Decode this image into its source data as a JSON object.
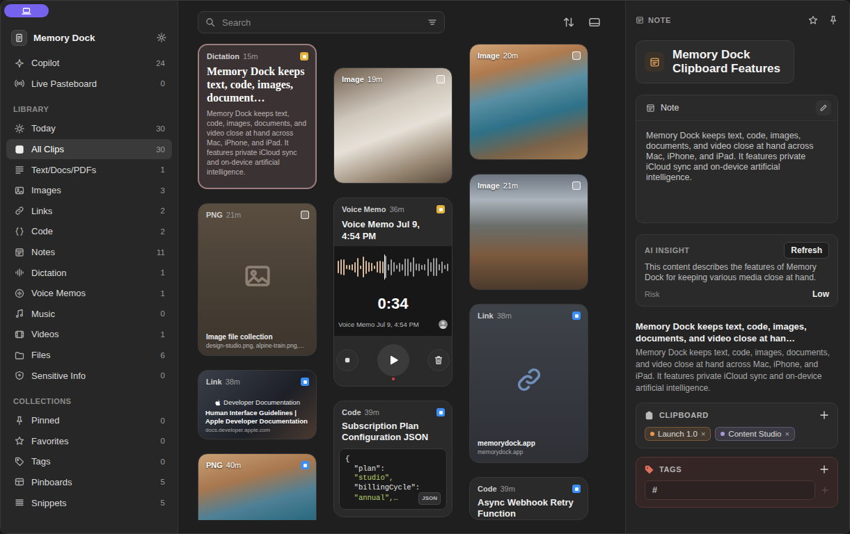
{
  "sidebar": {
    "title": "Memory Dock",
    "top": [
      {
        "label": "Copilot",
        "count": "24",
        "selected": false
      },
      {
        "label": "Live Pasteboard",
        "count": "0",
        "selected": false
      }
    ],
    "sections": [
      {
        "title": "LIBRARY",
        "items": [
          {
            "label": "Today",
            "count": "30",
            "selected": false
          },
          {
            "label": "All Clips",
            "count": "30",
            "selected": true
          },
          {
            "label": "Text/Docs/PDFs",
            "count": "1",
            "selected": false
          },
          {
            "label": "Images",
            "count": "3",
            "selected": false
          },
          {
            "label": "Links",
            "count": "2",
            "selected": false
          },
          {
            "label": "Code",
            "count": "2",
            "selected": false
          },
          {
            "label": "Notes",
            "count": "11",
            "selected": false
          },
          {
            "label": "Dictation",
            "count": "1",
            "selected": false
          },
          {
            "label": "Voice Memos",
            "count": "1",
            "selected": false
          },
          {
            "label": "Music",
            "count": "0",
            "selected": false
          },
          {
            "label": "Videos",
            "count": "1",
            "selected": false
          },
          {
            "label": "Files",
            "count": "6",
            "selected": false
          },
          {
            "label": "Sensitive Info",
            "count": "0",
            "selected": false
          }
        ]
      },
      {
        "title": "COLLECTIONS",
        "items": [
          {
            "label": "Pinned",
            "count": "0",
            "selected": false
          },
          {
            "label": "Favorites",
            "count": "0",
            "selected": false
          },
          {
            "label": "Tags",
            "count": "0",
            "selected": false
          },
          {
            "label": "Pinboards",
            "count": "5",
            "selected": false
          },
          {
            "label": "Snippets",
            "count": "5",
            "selected": false
          }
        ]
      }
    ]
  },
  "search": {
    "placeholder": "Search"
  },
  "columns": [
    [
      {
        "kind": "text",
        "type": "Dictation",
        "age": "15m",
        "selected": true,
        "corner": {
          "kind": "app",
          "color": "#e3b23c"
        },
        "title": "Memory Dock keeps text, code, images, document…",
        "body": "Memory Dock keeps text, code, images, documents, and video close at hand across Mac, iPhone, and iPad. It features private iCloud sync and on-device artificial intelligence."
      },
      {
        "kind": "file",
        "type": "PNG",
        "age": "21m",
        "selected": false,
        "corner": {
          "kind": "checkbox",
          "checked": false
        },
        "caption": "Image file collection",
        "subtitle": "design-studio.png, alpine-train.png,…"
      },
      {
        "kind": "link-preview",
        "type": "Link",
        "age": "38m",
        "selected": false,
        "corner": {
          "kind": "app",
          "color": "#3b8ef3"
        },
        "site": "Developer Documentation",
        "title": "Human Interface Guidelines | Apple Developer Documentation",
        "url": "docs.developer.apple.com"
      },
      {
        "kind": "image",
        "type": "PNG",
        "age": "40m",
        "selected": false,
        "corner": {
          "kind": "app",
          "color": "#3b8ef3"
        }
      }
    ],
    [
      {
        "kind": "image",
        "type": "Image",
        "age": "19m",
        "selected": false,
        "corner": {
          "kind": "checkbox",
          "checked": false
        }
      },
      {
        "kind": "voice",
        "type": "Voice Memo",
        "age": "36m",
        "selected": false,
        "corner": {
          "kind": "app",
          "color": "#e3b23c"
        },
        "title": "Voice Memo Jul 9, 4:54 PM",
        "level": 0.43,
        "time": "0:34",
        "caption": "Voice Memo Jul 9, 4:54 PM"
      },
      {
        "kind": "code",
        "type": "Code",
        "age": "39m",
        "selected": false,
        "corner": {
          "kind": "app",
          "color": "#3b8ef3"
        },
        "title": "Subscription Plan Configuration JSON",
        "code": [
          "{",
          "  \"plan\":",
          "  \"studio\",",
          "  \"billingCycle\":",
          "  \"annual\",…"
        ],
        "badge": "JSON"
      }
    ],
    [
      {
        "kind": "image",
        "type": "Image",
        "age": "20m",
        "selected": false,
        "corner": {
          "kind": "checkbox",
          "checked": false
        }
      },
      {
        "kind": "image",
        "type": "Image",
        "age": "21m",
        "selected": false,
        "corner": {
          "kind": "checkbox",
          "checked": false
        }
      },
      {
        "kind": "link",
        "type": "Link",
        "age": "38m",
        "selected": false,
        "corner": {
          "kind": "app",
          "color": "#3b8ef3"
        },
        "title": "memorydock.app",
        "url": "memorydock.app"
      },
      {
        "kind": "code",
        "type": "Code",
        "age": "39m",
        "selected": false,
        "corner": {
          "kind": "app",
          "color": "#3b8ef3"
        },
        "title": "Async Webhook Retry Function"
      }
    ]
  ],
  "detail": {
    "header": "NOTE",
    "title": "Memory Dock Clipboard Features",
    "note": {
      "label": "Note",
      "text": "Memory Dock keeps text, code, images, documents, and video close at hand across Mac, iPhone, and iPad. It features private iCloud sync and on-device artificial intelligence."
    },
    "insight": {
      "label": "AI INSIGHT",
      "button": "Refresh",
      "text": "This content describes the features of Memory Dock for keeping various media close at hand.",
      "risk_label": "Risk",
      "risk": "Low"
    },
    "summary": {
      "title": "Memory Dock keeps text, code, images, documents, and video close at han…",
      "body": "Memory Dock keeps text, code, images, documents, and video close at hand across Mac, iPhone, and iPad. It features private iCloud sync and on-device artificial intelligence."
    },
    "clipboard": {
      "label": "CLIPBOARD",
      "chips": [
        {
          "label": "Launch 1.0",
          "remove": "×",
          "color": "#e59a52"
        },
        {
          "label": "Content Studio",
          "remove": "×",
          "color": "#a99ad6"
        }
      ]
    },
    "tags": {
      "label": "TAGS",
      "input": "#"
    }
  }
}
